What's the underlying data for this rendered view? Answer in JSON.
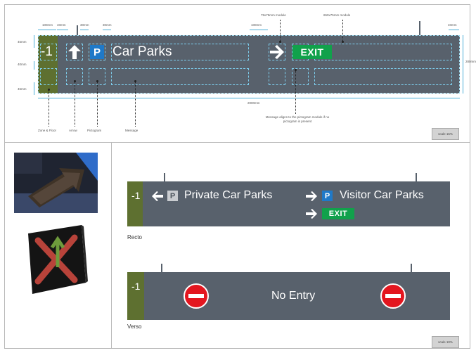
{
  "diagram": {
    "dims": {
      "d100_left": "100mm",
      "d40_left": "40mm",
      "d30_a": "30mm",
      "d30_b": "30mm",
      "d100_mid": "100mm",
      "d40_right": "40mm",
      "module_75": "75x75mm module",
      "module_650": "650x75mm module",
      "h45_top": "45mm",
      "h40": "40mm",
      "h45_bottom": "45mm",
      "height_total": "280mm",
      "width_total": "2000mm"
    },
    "sign": {
      "zone": "-1",
      "message": "Car Parks",
      "p_symbol": "P",
      "exit": "EXIT"
    },
    "labels": {
      "zone_floor": "Zone & Floor",
      "arrow": "Arrow",
      "pictogram": "Pictogram",
      "message": "Message",
      "note": "Message aligns to the pictogram module if no pictogram is present"
    },
    "scale": "scale 15%"
  },
  "examples": {
    "recto": {
      "zone": "-1",
      "msg_left": "Private Car Parks",
      "msg_right": "Visitor Car Parks",
      "p_symbol": "P",
      "exit": "EXIT",
      "caption": "Recto"
    },
    "verso": {
      "zone": "-1",
      "message": "No Entry",
      "caption": "Verso"
    },
    "scale": "scale 10%"
  },
  "colors": {
    "sign_grey": "#58616c",
    "zone_green": "#5e7030",
    "parking_blue": "#1f79c8",
    "exit_green": "#11a14b",
    "no_entry_red": "#e3161f",
    "guide_cyan": "#7ed0f0"
  },
  "icons": [
    "arrow-up-icon",
    "arrow-right-icon",
    "arrow-left-icon",
    "parking-icon",
    "no-entry-icon"
  ]
}
